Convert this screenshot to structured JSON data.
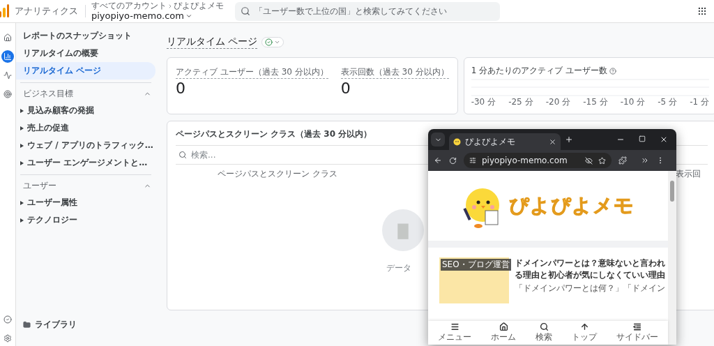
{
  "header": {
    "product": "アナリティクス",
    "breadcrumb": [
      "すべてのアカウント",
      "ぴよぴよメモ"
    ],
    "property": "piyopiyo-memo.com",
    "search_placeholder": "「ユーザー数で上位の国」と検索してみてください"
  },
  "rail": [
    {
      "kind": "home",
      "selected": false
    },
    {
      "kind": "reports",
      "selected": true
    },
    {
      "kind": "explore",
      "selected": false
    },
    {
      "kind": "advertising",
      "selected": false
    }
  ],
  "sidebar": {
    "top_items": [
      {
        "label": "レポートのスナップショット",
        "selected": false
      },
      {
        "label": "リアルタイムの概要",
        "selected": false
      },
      {
        "label": "リアルタイム ページ",
        "selected": true
      }
    ],
    "sections": [
      {
        "title": "ビジネス目標",
        "expanded": true,
        "items": [
          "見込み顧客の発掘",
          "売上の促進",
          "ウェブ / アプリのトラフィック…",
          "ユーザー エンゲージメントと…"
        ]
      },
      {
        "title": "ユーザー",
        "expanded": true,
        "items": [
          "ユーザー属性",
          "テクノロジー"
        ]
      }
    ],
    "library": "ライブラリ"
  },
  "page": {
    "title": "リアルタイム ページ",
    "healthy": true
  },
  "metrics": [
    {
      "label": "アクティブ ユーザー（過去 30 分以内）",
      "value": "0"
    },
    {
      "label": "表示回数（過去 30 分以内）",
      "value": "0"
    }
  ],
  "minute_chart": {
    "title": "1 分あたりのアクティブ ユーザー数",
    "x_labels": [
      "-30 分",
      "-25 分",
      "-20 分",
      "-15 分",
      "-10 分",
      "-5 分",
      "-1 分"
    ]
  },
  "table": {
    "title": "ページパスとスクリーン クラス（過去 30 分以内）",
    "search_placeholder": "検索...",
    "columns": [
      "ページパスとスクリーン クラス",
      "表示回"
    ],
    "empty_text": "データ"
  },
  "browser": {
    "tab_title": "ぴよぴよメモ",
    "url": "piyopiyo-memo.com",
    "logo_text": "ぴよぴよメモ",
    "article": {
      "tag": "SEO・ブログ運営",
      "title": "ドメインパワーとは？意味ないと言われる理由と初心者が気にしなくていい理由",
      "excerpt": "「ドメインパワーとは何？」「ドメイン"
    },
    "nav": [
      {
        "kind": "menu",
        "label": "メニュー"
      },
      {
        "kind": "home",
        "label": "ホーム"
      },
      {
        "kind": "search",
        "label": "検索"
      },
      {
        "kind": "top",
        "label": "トップ"
      },
      {
        "kind": "sidebar",
        "label": "サイドバー"
      }
    ]
  }
}
